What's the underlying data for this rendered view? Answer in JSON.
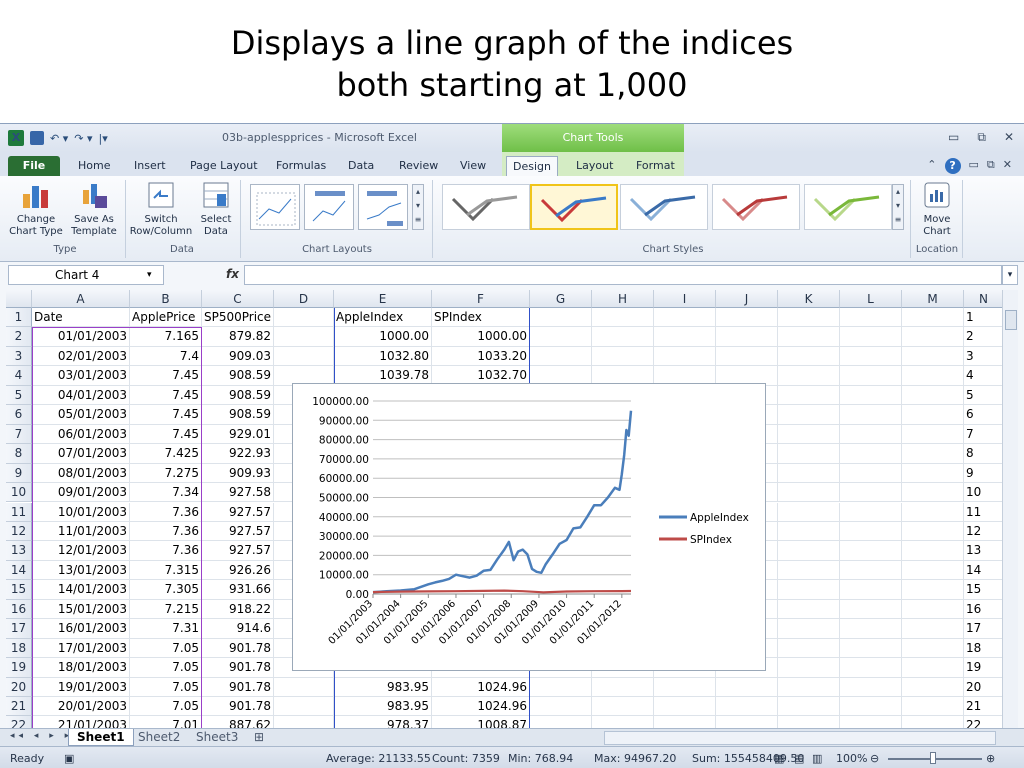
{
  "slide": {
    "title_line1": "Displays a line graph of the indices",
    "title_line2": "both starting at 1,000"
  },
  "window": {
    "title": "03b-applespprices - Microsoft Excel",
    "context_tab": "Chart Tools"
  },
  "tabs": [
    "File",
    "Home",
    "Insert",
    "Page Layout",
    "Formulas",
    "Data",
    "Review",
    "View",
    "Design",
    "Layout",
    "Format"
  ],
  "ribbon": {
    "change_chart_type": "Change\nChart Type",
    "change_chart_type_l1": "Change",
    "change_chart_type_l2": "Chart Type",
    "save_as_template_l1": "Save As",
    "save_as_template_l2": "Template",
    "group_type": "Type",
    "switch_l1": "Switch",
    "switch_l2": "Row/Column",
    "select_l1": "Select",
    "select_l2": "Data",
    "group_data": "Data",
    "group_layouts": "Chart Layouts",
    "group_styles": "Chart Styles",
    "move_l1": "Move",
    "move_l2": "Chart",
    "group_location": "Location"
  },
  "formula_bar": {
    "name_box": "Chart 4",
    "fx": "fx",
    "formula": ""
  },
  "columns": [
    "A",
    "B",
    "C",
    "D",
    "E",
    "F",
    "G",
    "H",
    "I",
    "J",
    "K",
    "L",
    "M",
    "N"
  ],
  "rows": [
    {
      "n": "1",
      "a": "Date",
      "b": "ApplePrice",
      "c": "SP500Price",
      "e": "AppleIndex",
      "f": "SPIndex"
    },
    {
      "n": "2",
      "a": "01/01/2003",
      "b": "7.165",
      "c": "879.82",
      "e": "1000.00",
      "f": "1000.00"
    },
    {
      "n": "3",
      "a": "02/01/2003",
      "b": "7.4",
      "c": "909.03",
      "e": "1032.80",
      "f": "1033.20"
    },
    {
      "n": "4",
      "a": "03/01/2003",
      "b": "7.45",
      "c": "908.59",
      "e": "1039.78",
      "f": "1032.70"
    },
    {
      "n": "5",
      "a": "04/01/2003",
      "b": "7.45",
      "c": "908.59",
      "e": "",
      "f": ""
    },
    {
      "n": "6",
      "a": "05/01/2003",
      "b": "7.45",
      "c": "908.59",
      "e": "",
      "f": ""
    },
    {
      "n": "7",
      "a": "06/01/2003",
      "b": "7.45",
      "c": "929.01",
      "e": "",
      "f": ""
    },
    {
      "n": "8",
      "a": "07/01/2003",
      "b": "7.425",
      "c": "922.93",
      "e": "",
      "f": ""
    },
    {
      "n": "9",
      "a": "08/01/2003",
      "b": "7.275",
      "c": "909.93",
      "e": "",
      "f": ""
    },
    {
      "n": "10",
      "a": "09/01/2003",
      "b": "7.34",
      "c": "927.58",
      "e": "",
      "f": ""
    },
    {
      "n": "11",
      "a": "10/01/2003",
      "b": "7.36",
      "c": "927.57",
      "e": "",
      "f": ""
    },
    {
      "n": "12",
      "a": "11/01/2003",
      "b": "7.36",
      "c": "927.57",
      "e": "",
      "f": ""
    },
    {
      "n": "13",
      "a": "12/01/2003",
      "b": "7.36",
      "c": "927.57",
      "e": "",
      "f": ""
    },
    {
      "n": "14",
      "a": "13/01/2003",
      "b": "7.315",
      "c": "926.26",
      "e": "",
      "f": ""
    },
    {
      "n": "15",
      "a": "14/01/2003",
      "b": "7.305",
      "c": "931.66",
      "e": "",
      "f": ""
    },
    {
      "n": "16",
      "a": "15/01/2003",
      "b": "7.215",
      "c": "918.22",
      "e": "",
      "f": ""
    },
    {
      "n": "17",
      "a": "16/01/2003",
      "b": "7.31",
      "c": "914.6",
      "e": "",
      "f": ""
    },
    {
      "n": "18",
      "a": "17/01/2003",
      "b": "7.05",
      "c": "901.78",
      "e": "",
      "f": ""
    },
    {
      "n": "19",
      "a": "18/01/2003",
      "b": "7.05",
      "c": "901.78",
      "e": "",
      "f": ""
    },
    {
      "n": "20",
      "a": "19/01/2003",
      "b": "7.05",
      "c": "901.78",
      "e": "983.95",
      "f": "1024.96"
    },
    {
      "n": "21",
      "a": "20/01/2003",
      "b": "7.05",
      "c": "901.78",
      "e": "983.95",
      "f": "1024.96"
    },
    {
      "n": "22",
      "a": "21/01/2003",
      "b": "7.01",
      "c": "887.62",
      "e": "978.37",
      "f": "1008.87"
    }
  ],
  "sheets": [
    "Sheet1",
    "Sheet2",
    "Sheet3"
  ],
  "status": {
    "ready": "Ready",
    "average": "Average: 21133.55",
    "count": "Count: 7359",
    "min": "Min: 768.94",
    "max": "Max: 94967.20",
    "sum": "Sum: 155458409.50",
    "zoom": "100%"
  },
  "chart_data": {
    "type": "line",
    "title": "",
    "xlabel": "",
    "ylabel": "",
    "ylim": [
      0,
      100000
    ],
    "y_ticks": [
      "100000.00",
      "90000.00",
      "80000.00",
      "70000.00",
      "60000.00",
      "50000.00",
      "40000.00",
      "30000.00",
      "20000.00",
      "10000.00",
      "0.00"
    ],
    "x_ticks": [
      "01/01/2003",
      "01/01/2004",
      "01/01/2005",
      "01/01/2006",
      "01/01/2007",
      "01/01/2008",
      "01/01/2009",
      "01/01/2010",
      "01/01/2011",
      "01/01/2012"
    ],
    "legend_position": "right",
    "series": [
      {
        "name": "AppleIndex",
        "color": "#4a7ebb",
        "x": [
          "2003-01",
          "2003-07",
          "2004-01",
          "2004-07",
          "2005-01",
          "2005-04",
          "2005-07",
          "2005-10",
          "2006-01",
          "2006-03",
          "2006-07",
          "2006-10",
          "2007-01",
          "2007-04",
          "2007-07",
          "2007-10",
          "2007-12",
          "2008-02",
          "2008-04",
          "2008-06",
          "2008-08",
          "2008-10",
          "2008-12",
          "2009-02",
          "2009-04",
          "2009-07",
          "2009-10",
          "2010-01",
          "2010-04",
          "2010-07",
          "2010-10",
          "2011-01",
          "2011-04",
          "2011-07",
          "2011-10",
          "2011-12",
          "2012-01",
          "2012-02",
          "2012-03",
          "2012-04",
          "2012-05"
        ],
        "values": [
          1000,
          1400,
          1800,
          2500,
          5000,
          6000,
          6800,
          7800,
          10000,
          9500,
          8500,
          9500,
          12000,
          12500,
          18000,
          23000,
          27000,
          17500,
          22000,
          23000,
          20500,
          13000,
          11500,
          11000,
          15500,
          20500,
          26000,
          28000,
          34000,
          34500,
          40000,
          46000,
          46000,
          50000,
          55000,
          54000,
          62000,
          72000,
          85000,
          82000,
          94967
        ]
      },
      {
        "name": "SPIndex",
        "color": "#be4b48",
        "x": [
          "2003-01",
          "2004-01",
          "2005-01",
          "2006-01",
          "2007-01",
          "2007-10",
          "2008-06",
          "2009-03",
          "2010-01",
          "2011-01",
          "2012-01",
          "2012-05"
        ],
        "values": [
          1000,
          1250,
          1350,
          1450,
          1600,
          1780,
          1450,
          870,
          1300,
          1450,
          1500,
          1550
        ]
      }
    ]
  }
}
